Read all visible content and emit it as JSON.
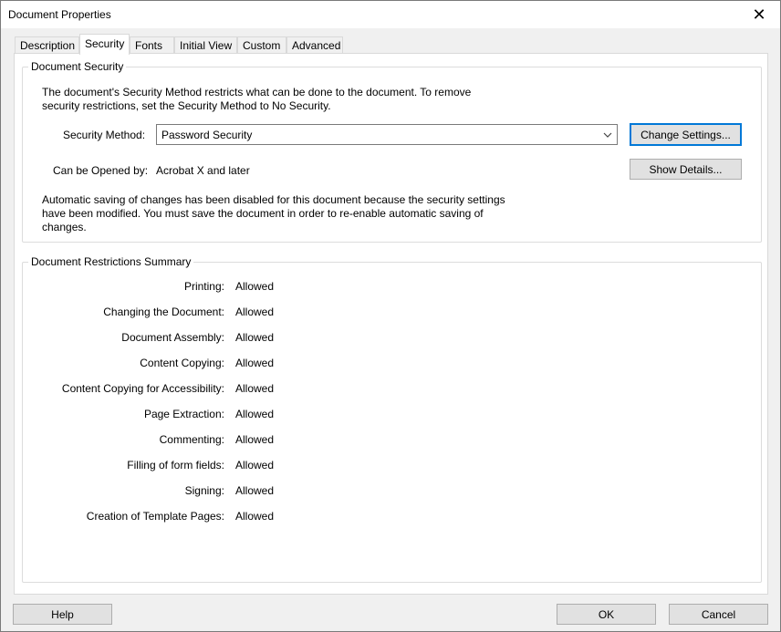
{
  "window": {
    "title": "Document Properties"
  },
  "tabs": [
    {
      "label": "Description",
      "active": false
    },
    {
      "label": "Security",
      "active": true
    },
    {
      "label": "Fonts",
      "active": false
    },
    {
      "label": "Initial View",
      "active": false
    },
    {
      "label": "Custom",
      "active": false
    },
    {
      "label": "Advanced",
      "active": false
    }
  ],
  "security": {
    "group_title": "Document Security",
    "intro_line1": "The document's Security Method restricts what can be done to the document. To remove",
    "intro_line2": "security restrictions, set the Security Method to No Security.",
    "method_label": "Security Method:",
    "method_value": "Password Security",
    "change_settings": "Change Settings...",
    "opened_by_label": "Can be Opened by:",
    "opened_by_value": "Acrobat X and later",
    "show_details": "Show Details...",
    "autosave_line1": "Automatic saving of changes has been disabled for this document because the security settings",
    "autosave_line2": "have been modified. You must save the document in order to re-enable automatic saving of",
    "autosave_line3": "changes."
  },
  "restrictions": {
    "group_title": "Document Restrictions Summary",
    "rows": [
      {
        "label": "Printing:",
        "value": "Allowed"
      },
      {
        "label": "Changing the Document:",
        "value": "Allowed"
      },
      {
        "label": "Document Assembly:",
        "value": "Allowed"
      },
      {
        "label": "Content Copying:",
        "value": "Allowed"
      },
      {
        "label": "Content Copying for Accessibility:",
        "value": "Allowed"
      },
      {
        "label": "Page Extraction:",
        "value": "Allowed"
      },
      {
        "label": "Commenting:",
        "value": "Allowed"
      },
      {
        "label": "Filling of form fields:",
        "value": "Allowed"
      },
      {
        "label": "Signing:",
        "value": "Allowed"
      },
      {
        "label": "Creation of Template Pages:",
        "value": "Allowed"
      }
    ]
  },
  "footer": {
    "help": "Help",
    "ok": "OK",
    "cancel": "Cancel"
  },
  "icons": {
    "close": "close-icon",
    "dropdown": "chevron-down-icon"
  },
  "colors": {
    "default_button_border": "#0078d7",
    "button_face": "#e1e1e1"
  }
}
